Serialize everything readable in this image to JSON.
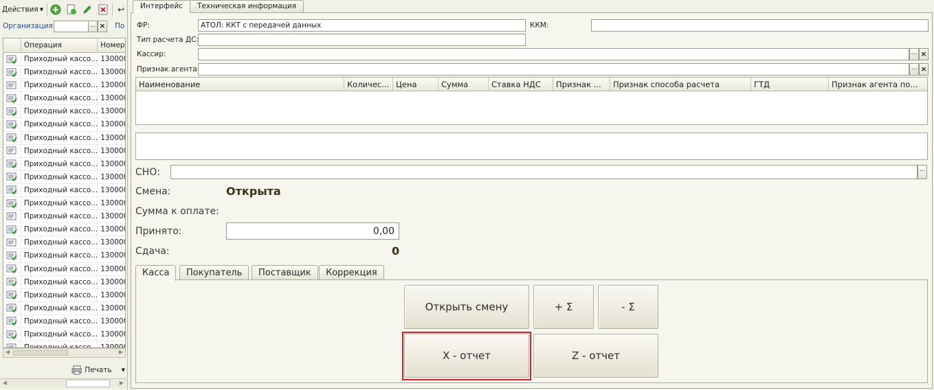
{
  "left_panel": {
    "actions_label": "Действия",
    "org_label": "Организация:",
    "org_value": "",
    "org_extra_label": "По",
    "list": {
      "headers": [
        "",
        "Операция",
        "Номер"
      ],
      "rows": [
        {
          "op": "Приходный кассо...",
          "num": "130000",
          "icon": "doc-posted-icon"
        },
        {
          "op": "Приходный кассо...",
          "num": "130000",
          "icon": "doc-posted-icon"
        },
        {
          "op": "Приходный кассо...",
          "num": "130000",
          "icon": "doc-icon"
        },
        {
          "op": "Приходный кассо...",
          "num": "130000",
          "icon": "doc-posted-icon"
        },
        {
          "op": "Приходный кассо...",
          "num": "130000",
          "icon": "doc-posted-icon"
        },
        {
          "op": "Приходный кассо...",
          "num": "130000",
          "icon": "doc-posted-icon"
        },
        {
          "op": "Приходный кассо...",
          "num": "130000",
          "icon": "doc-posted-icon"
        },
        {
          "op": "Приходный кассо...",
          "num": "130000",
          "icon": "doc-icon"
        },
        {
          "op": "Приходный кассо...",
          "num": "130000",
          "icon": "doc-posted-icon"
        },
        {
          "op": "Приходный кассо...",
          "num": "130000",
          "icon": "doc-posted-icon"
        },
        {
          "op": "Приходный кассо...",
          "num": "130000",
          "icon": "doc-posted-icon"
        },
        {
          "op": "Приходный кассо...",
          "num": "130000",
          "icon": "doc-posted-icon"
        },
        {
          "op": "Приходный кассо...",
          "num": "130000",
          "icon": "doc-icon"
        },
        {
          "op": "Приходный кассо...",
          "num": "130000",
          "icon": "doc-posted-icon"
        },
        {
          "op": "Приходный кассо...",
          "num": "130000",
          "icon": "doc-icon"
        },
        {
          "op": "Приходный кассо...",
          "num": "130000",
          "icon": "doc-posted-icon"
        },
        {
          "op": "Приходный кассо...",
          "num": "130000",
          "icon": "doc-posted-icon"
        },
        {
          "op": "Приходный кассо...",
          "num": "130000",
          "icon": "doc-posted-icon"
        },
        {
          "op": "Приходный кассо...",
          "num": "130000",
          "icon": "doc-posted-icon"
        },
        {
          "op": "Приходный кассо...",
          "num": "130000",
          "icon": "doc-posted-icon"
        },
        {
          "op": "Приходный кассо...",
          "num": "130000",
          "icon": "doc-posted-icon"
        },
        {
          "op": "Приходный кассо...",
          "num": "130000",
          "icon": "doc-posted-icon"
        },
        {
          "op": "Приходный кассо...",
          "num": "130000",
          "icon": "doc-posted-icon"
        },
        {
          "op": "Приходный кассо...",
          "num": "130000",
          "icon": "doc-posted-icon"
        }
      ]
    },
    "print_label": "Печать"
  },
  "top_tabs": [
    "Интерфейс",
    "Техническая информация"
  ],
  "form": {
    "fr_label": "ФР:",
    "fr_value": "АТОЛ: ККТ с передачей данных",
    "kkm_label": "ККМ:",
    "kkm_value": "",
    "payment_type_label": "Тип расчета ДС:",
    "payment_type_value": "",
    "cashier_label": "Кассир:",
    "cashier_value": "",
    "agent_label": "Признак агента:",
    "agent_value": "",
    "select_button": "..."
  },
  "goods_grid": {
    "headers": [
      "Наименование",
      "Количес...",
      "Цена",
      "Сумма",
      "Ставка НДС",
      "Признак ...",
      "Признак способа расчета",
      "ГТД",
      "Признак агента по..."
    ]
  },
  "cno_label": "СНО:",
  "cno_value": "",
  "shift_label": "Смена:",
  "shift_value": "Открыта",
  "sum_to_pay_label": "Сумма к оплате:",
  "received_label": "Принято:",
  "received_value": "0,00",
  "change_label": "Сдача:",
  "change_value": "0",
  "bottom_tabs": [
    "Касса",
    "Покупатель",
    "Поставщик",
    "Коррекция"
  ],
  "buttons": {
    "open_shift": "Открыть смену",
    "plus_sum": "+ Σ",
    "minus_sum": "- Σ",
    "x_report": "X - отчет",
    "z_report": "Z - отчет"
  },
  "colors": {
    "highlight": "#d6202a",
    "background": "#f2f1e8",
    "org_label": "#1d4fa0"
  }
}
